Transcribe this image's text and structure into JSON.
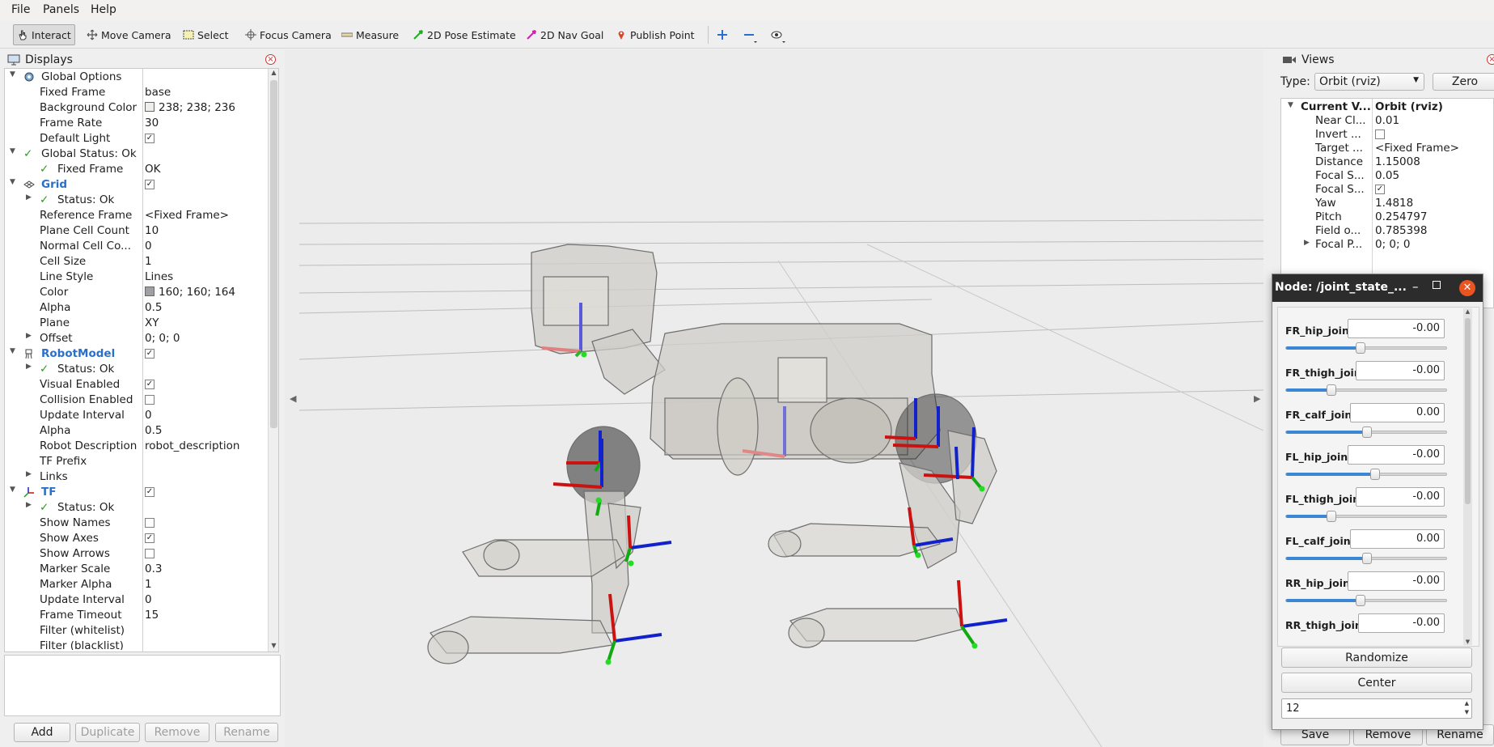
{
  "menu": {
    "items": [
      "File",
      "Panels",
      "Help"
    ]
  },
  "toolbar": {
    "tools": [
      {
        "label": "Interact",
        "icon": "hand-cursor-icon"
      },
      {
        "label": "Move Camera",
        "icon": "move-arrows-icon"
      },
      {
        "label": "Select",
        "icon": "select-box-icon"
      },
      {
        "label": "Focus Camera",
        "icon": "crosshair-icon"
      },
      {
        "label": "Measure",
        "icon": "ruler-icon"
      },
      {
        "label": "2D Pose Estimate",
        "icon": "green-arrow-icon"
      },
      {
        "label": "2D Nav Goal",
        "icon": "magenta-arrow-icon"
      },
      {
        "label": "Publish Point",
        "icon": "map-pin-icon"
      }
    ],
    "extra_icons": [
      "plus-icon",
      "minus-icon",
      "eye-icon"
    ]
  },
  "displays": {
    "title": "Displays",
    "rows": [
      {
        "k": "Global Options"
      },
      {
        "k": "Fixed Frame",
        "v": "base"
      },
      {
        "k": "Background Color",
        "v": "238; 238; 236"
      },
      {
        "k": "Frame Rate",
        "v": "30"
      },
      {
        "k": "Default Light"
      },
      {
        "k": "Global Status: Ok"
      },
      {
        "k": "Fixed Frame",
        "v": "OK"
      },
      {
        "k": "Grid"
      },
      {
        "k": "Status: Ok"
      },
      {
        "k": "Reference Frame",
        "v": "<Fixed Frame>"
      },
      {
        "k": "Plane Cell Count",
        "v": "10"
      },
      {
        "k": "Normal Cell Co...",
        "v": "0"
      },
      {
        "k": "Cell Size",
        "v": "1"
      },
      {
        "k": "Line Style",
        "v": "Lines"
      },
      {
        "k": "Color",
        "v": "160; 160; 164"
      },
      {
        "k": "Alpha",
        "v": "0.5"
      },
      {
        "k": "Plane",
        "v": "XY"
      },
      {
        "k": "Offset",
        "v": "0; 0; 0"
      },
      {
        "k": "RobotModel"
      },
      {
        "k": "Status: Ok"
      },
      {
        "k": "Visual Enabled"
      },
      {
        "k": "Collision Enabled"
      },
      {
        "k": "Update Interval",
        "v": "0"
      },
      {
        "k": "Alpha",
        "v": "0.5"
      },
      {
        "k": "Robot Description",
        "v": "robot_description"
      },
      {
        "k": "TF Prefix"
      },
      {
        "k": "Links"
      },
      {
        "k": "TF"
      },
      {
        "k": "Status: Ok"
      },
      {
        "k": "Show Names"
      },
      {
        "k": "Show Axes"
      },
      {
        "k": "Show Arrows"
      },
      {
        "k": "Marker Scale",
        "v": "0.3"
      },
      {
        "k": "Marker Alpha",
        "v": "1"
      },
      {
        "k": "Update Interval",
        "v": "0"
      },
      {
        "k": "Frame Timeout",
        "v": "15"
      },
      {
        "k": "Filter (whitelist)"
      },
      {
        "k": "Filter (blacklist)"
      }
    ],
    "buttons": [
      "Add",
      "Duplicate",
      "Remove",
      "Rename"
    ]
  },
  "views": {
    "title": "Views",
    "type_label": "Type:",
    "type_value": "Orbit (rviz)",
    "zero_button": "Zero",
    "rows": [
      {
        "k": "Current V...",
        "v": "Orbit (rviz)"
      },
      {
        "k": "Near Cl...",
        "v": "0.01"
      },
      {
        "k": "Invert ...",
        "v": ""
      },
      {
        "k": "Target ...",
        "v": "<Fixed Frame>"
      },
      {
        "k": "Distance",
        "v": "1.15008"
      },
      {
        "k": "Focal S...",
        "v": "0.05"
      },
      {
        "k": "Focal S...",
        "v": ""
      },
      {
        "k": "Yaw",
        "v": "1.4818"
      },
      {
        "k": "Pitch",
        "v": "0.254797"
      },
      {
        "k": "Field o...",
        "v": "0.785398"
      },
      {
        "k": "Focal P...",
        "v": "0; 0; 0"
      }
    ],
    "buttons": [
      "Save",
      "Remove",
      "Rename"
    ]
  },
  "joint_gui": {
    "title": "Node: /joint_state_...",
    "joints": [
      {
        "name": "FR_hip_joint",
        "value": "-0.00",
        "fraction": 0.46
      },
      {
        "name": "FR_thigh_joint",
        "value": "-0.00",
        "fraction": 0.28
      },
      {
        "name": "FR_calf_joint",
        "value": "0.00",
        "fraction": 0.5
      },
      {
        "name": "FL_hip_joint",
        "value": "-0.00",
        "fraction": 0.55
      },
      {
        "name": "FL_thigh_joint",
        "value": "-0.00",
        "fraction": 0.28
      },
      {
        "name": "FL_calf_joint",
        "value": "0.00",
        "fraction": 0.5
      },
      {
        "name": "RR_hip_joint",
        "value": "-0.00",
        "fraction": 0.46
      },
      {
        "name": "RR_thigh_joint",
        "value": "-0.00",
        "fraction": 0.28
      }
    ],
    "randomize_label": "Randomize",
    "center_label": "Center",
    "spin_value": "12"
  },
  "colors": {
    "accent": "#3b87d6",
    "status_ok": "#2a9d1f",
    "close_button": "#e95420",
    "axis_x": "#cc1111",
    "axis_y": "#11aa11",
    "axis_z": "#1122cc"
  }
}
